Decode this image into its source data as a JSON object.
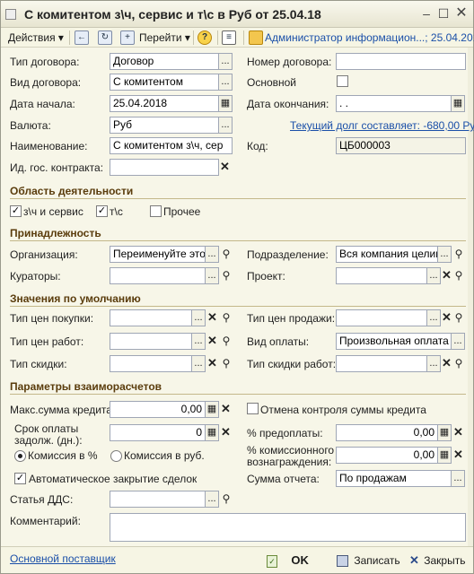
{
  "window": {
    "title": "С комитентом з\\ч, сервис и т\\с в Руб от 25.04.18"
  },
  "toolbar": {
    "actions_label": "Действия",
    "goto_label": "Перейти",
    "help_icon": "?",
    "info_text": "Администратор информацион...; 25.04.201..."
  },
  "fields": {
    "contract_type": {
      "label": "Тип договора:",
      "value": "Договор"
    },
    "contract_kind": {
      "label": "Вид договора:",
      "value": "С комитентом"
    },
    "start_date": {
      "label": "Дата начала:",
      "value": "25.04.2018"
    },
    "currency": {
      "label": "Валюта:",
      "value": "Руб"
    },
    "name": {
      "label": "Наименование:",
      "value": "С комитентом з\\ч, сер"
    },
    "gov_contract": {
      "label": "Ид. гос. контракта:",
      "value": ""
    },
    "contract_number": {
      "label": "Номер договора:",
      "value": ""
    },
    "main": {
      "label": "Основной"
    },
    "end_date": {
      "label": "Дата окончания:",
      "value": "  .  ."
    },
    "debt_link": "Текущий долг составляет: -680,00 Руб",
    "code": {
      "label": "Код:",
      "value": "ЦБ000003"
    }
  },
  "activity": {
    "title": "Область деятельности",
    "items": [
      {
        "label": "з\\ч и сервис",
        "checked": true
      },
      {
        "label": "т\\с",
        "checked": true
      },
      {
        "label": "Прочее",
        "checked": false
      }
    ]
  },
  "belonging": {
    "title": "Принадлежность",
    "organization": {
      "label": "Организация:",
      "value": "Переименуйте этот"
    },
    "division": {
      "label": "Подразделение:",
      "value": "Вся компания целикс"
    },
    "curators": {
      "label": "Кураторы:",
      "value": ""
    },
    "project": {
      "label": "Проект:",
      "value": ""
    }
  },
  "defaults": {
    "title": "Значения по умолчанию",
    "purchase_price": {
      "label": "Тип цен покупки:",
      "value": ""
    },
    "sale_price": {
      "label": "Тип цен продажи:",
      "value": ""
    },
    "work_price": {
      "label": "Тип цен работ:",
      "value": ""
    },
    "payment_kind": {
      "label": "Вид оплаты:",
      "value": "Произвольная оплата"
    },
    "discount": {
      "label": "Тип скидки:",
      "value": ""
    },
    "work_discount": {
      "label": "Тип скидки работ:",
      "value": ""
    }
  },
  "settlement": {
    "title": "Параметры взаиморасчетов",
    "max_credit": {
      "label": "Макс.сумма кредита:",
      "value": "0,00"
    },
    "cancel_credit_control": {
      "label": "Отмена контроля суммы кредита",
      "checked": false
    },
    "payment_term": {
      "label1": "Срок оплаты",
      "label2": "задолж. (дн.):",
      "value": "0"
    },
    "prepayment": {
      "label": "% предоплаты:",
      "value": "0,00"
    },
    "commission_pct": {
      "label": "Комиссия в %",
      "selected": true
    },
    "commission_rub": {
      "label": "Комиссия в руб.",
      "selected": false
    },
    "commission_reward": {
      "label1": "% комиссионного",
      "label2": "вознаграждения:",
      "value": "0,00"
    },
    "auto_close": {
      "label": "Автоматическое закрытие сделок",
      "checked": true
    },
    "report_sum": {
      "label": "Сумма отчета:",
      "value": "По продажам"
    },
    "dds": {
      "label": "Статья ДДС:",
      "value": ""
    },
    "comment": {
      "label": "Комментарий:",
      "value": ""
    }
  },
  "bottom": {
    "supplier_link": "Основной поставщик",
    "ok_label": "OK",
    "save_label": "Записать",
    "close_label": "Закрыть"
  }
}
